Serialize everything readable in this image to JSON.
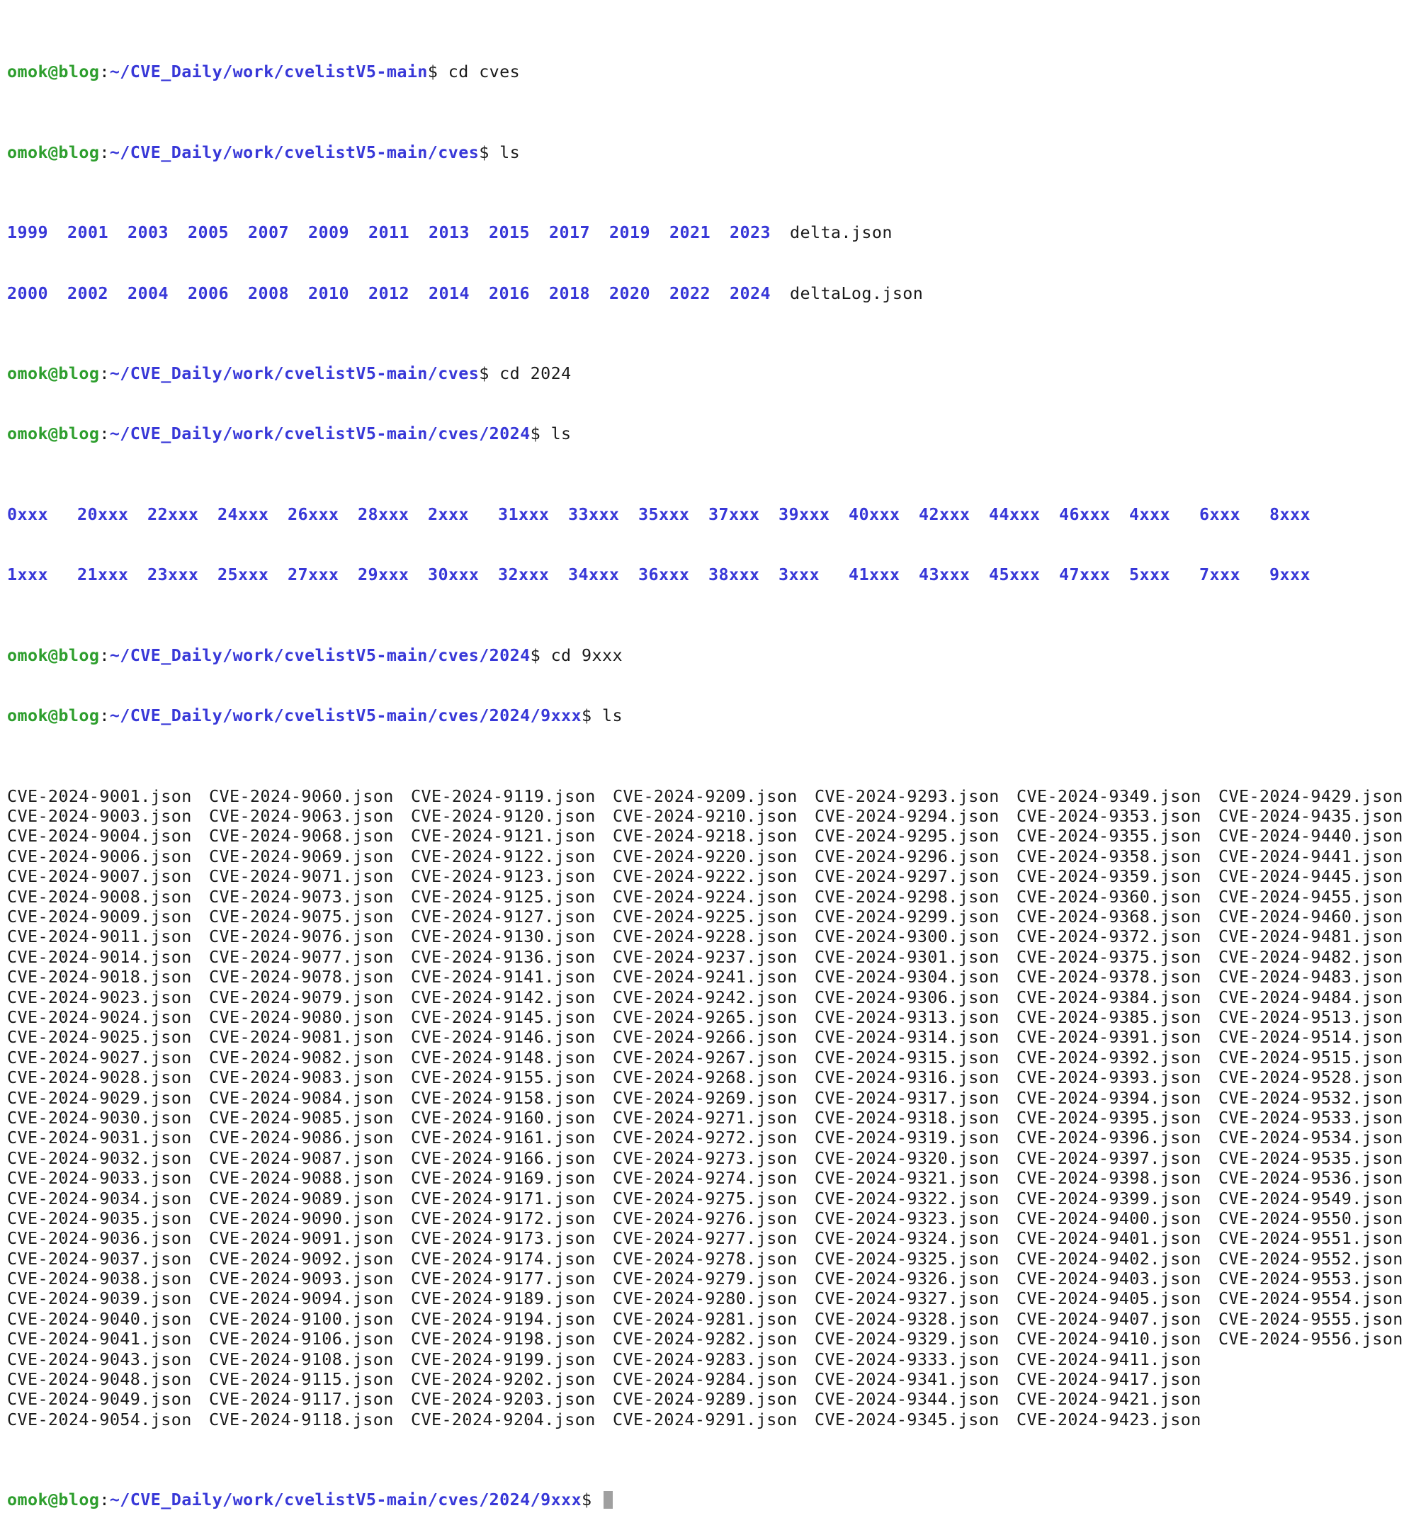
{
  "prompt": {
    "user": "omok@blog",
    "separator": ":",
    "symbol": "$"
  },
  "history": [
    {
      "path": "~/CVE_Daily/work/cvelistV5-main",
      "command": " cd cves"
    },
    {
      "path": "~/CVE_Daily/work/cvelistV5-main/cves",
      "command": " ls"
    }
  ],
  "ls_cves": {
    "row1_dirs": [
      "1999",
      "2001",
      "2003",
      "2005",
      "2007",
      "2009",
      "2011",
      "2013",
      "2015",
      "2017",
      "2019",
      "2021",
      "2023"
    ],
    "row1_file": "delta.json",
    "row2_dirs": [
      "2000",
      "2002",
      "2004",
      "2006",
      "2008",
      "2010",
      "2012",
      "2014",
      "2016",
      "2018",
      "2020",
      "2022",
      "2024"
    ],
    "row2_file": "deltaLog.json"
  },
  "history2": [
    {
      "path": "~/CVE_Daily/work/cvelistV5-main/cves",
      "command": " cd 2024"
    },
    {
      "path": "~/CVE_Daily/work/cvelistV5-main/cves/2024",
      "command": " ls"
    }
  ],
  "ls_2024": {
    "row1": [
      "0xxx",
      "20xxx",
      "22xxx",
      "24xxx",
      "26xxx",
      "28xxx",
      "2xxx",
      "31xxx",
      "33xxx",
      "35xxx",
      "37xxx",
      "39xxx",
      "40xxx",
      "42xxx",
      "44xxx",
      "46xxx",
      "4xxx",
      "6xxx",
      "8xxx"
    ],
    "row2": [
      "1xxx",
      "21xxx",
      "23xxx",
      "25xxx",
      "27xxx",
      "29xxx",
      "30xxx",
      "32xxx",
      "34xxx",
      "36xxx",
      "38xxx",
      "3xxx",
      "41xxx",
      "43xxx",
      "45xxx",
      "47xxx",
      "5xxx",
      "7xxx",
      "9xxx"
    ]
  },
  "history3": [
    {
      "path": "~/CVE_Daily/work/cvelistV5-main/cves/2024",
      "command": " cd 9xxx"
    },
    {
      "path": "~/CVE_Daily/work/cvelistV5-main/cves/2024/9xxx",
      "command": " ls"
    }
  ],
  "ls_9xxx_rows": [
    [
      "CVE-2024-9001.json",
      "CVE-2024-9060.json",
      "CVE-2024-9119.json",
      "CVE-2024-9209.json",
      "CVE-2024-9293.json",
      "CVE-2024-9349.json",
      "CVE-2024-9429.json"
    ],
    [
      "CVE-2024-9003.json",
      "CVE-2024-9063.json",
      "CVE-2024-9120.json",
      "CVE-2024-9210.json",
      "CVE-2024-9294.json",
      "CVE-2024-9353.json",
      "CVE-2024-9435.json"
    ],
    [
      "CVE-2024-9004.json",
      "CVE-2024-9068.json",
      "CVE-2024-9121.json",
      "CVE-2024-9218.json",
      "CVE-2024-9295.json",
      "CVE-2024-9355.json",
      "CVE-2024-9440.json"
    ],
    [
      "CVE-2024-9006.json",
      "CVE-2024-9069.json",
      "CVE-2024-9122.json",
      "CVE-2024-9220.json",
      "CVE-2024-9296.json",
      "CVE-2024-9358.json",
      "CVE-2024-9441.json"
    ],
    [
      "CVE-2024-9007.json",
      "CVE-2024-9071.json",
      "CVE-2024-9123.json",
      "CVE-2024-9222.json",
      "CVE-2024-9297.json",
      "CVE-2024-9359.json",
      "CVE-2024-9445.json"
    ],
    [
      "CVE-2024-9008.json",
      "CVE-2024-9073.json",
      "CVE-2024-9125.json",
      "CVE-2024-9224.json",
      "CVE-2024-9298.json",
      "CVE-2024-9360.json",
      "CVE-2024-9455.json"
    ],
    [
      "CVE-2024-9009.json",
      "CVE-2024-9075.json",
      "CVE-2024-9127.json",
      "CVE-2024-9225.json",
      "CVE-2024-9299.json",
      "CVE-2024-9368.json",
      "CVE-2024-9460.json"
    ],
    [
      "CVE-2024-9011.json",
      "CVE-2024-9076.json",
      "CVE-2024-9130.json",
      "CVE-2024-9228.json",
      "CVE-2024-9300.json",
      "CVE-2024-9372.json",
      "CVE-2024-9481.json"
    ],
    [
      "CVE-2024-9014.json",
      "CVE-2024-9077.json",
      "CVE-2024-9136.json",
      "CVE-2024-9237.json",
      "CVE-2024-9301.json",
      "CVE-2024-9375.json",
      "CVE-2024-9482.json"
    ],
    [
      "CVE-2024-9018.json",
      "CVE-2024-9078.json",
      "CVE-2024-9141.json",
      "CVE-2024-9241.json",
      "CVE-2024-9304.json",
      "CVE-2024-9378.json",
      "CVE-2024-9483.json"
    ],
    [
      "CVE-2024-9023.json",
      "CVE-2024-9079.json",
      "CVE-2024-9142.json",
      "CVE-2024-9242.json",
      "CVE-2024-9306.json",
      "CVE-2024-9384.json",
      "CVE-2024-9484.json"
    ],
    [
      "CVE-2024-9024.json",
      "CVE-2024-9080.json",
      "CVE-2024-9145.json",
      "CVE-2024-9265.json",
      "CVE-2024-9313.json",
      "CVE-2024-9385.json",
      "CVE-2024-9513.json"
    ],
    [
      "CVE-2024-9025.json",
      "CVE-2024-9081.json",
      "CVE-2024-9146.json",
      "CVE-2024-9266.json",
      "CVE-2024-9314.json",
      "CVE-2024-9391.json",
      "CVE-2024-9514.json"
    ],
    [
      "CVE-2024-9027.json",
      "CVE-2024-9082.json",
      "CVE-2024-9148.json",
      "CVE-2024-9267.json",
      "CVE-2024-9315.json",
      "CVE-2024-9392.json",
      "CVE-2024-9515.json"
    ],
    [
      "CVE-2024-9028.json",
      "CVE-2024-9083.json",
      "CVE-2024-9155.json",
      "CVE-2024-9268.json",
      "CVE-2024-9316.json",
      "CVE-2024-9393.json",
      "CVE-2024-9528.json"
    ],
    [
      "CVE-2024-9029.json",
      "CVE-2024-9084.json",
      "CVE-2024-9158.json",
      "CVE-2024-9269.json",
      "CVE-2024-9317.json",
      "CVE-2024-9394.json",
      "CVE-2024-9532.json"
    ],
    [
      "CVE-2024-9030.json",
      "CVE-2024-9085.json",
      "CVE-2024-9160.json",
      "CVE-2024-9271.json",
      "CVE-2024-9318.json",
      "CVE-2024-9395.json",
      "CVE-2024-9533.json"
    ],
    [
      "CVE-2024-9031.json",
      "CVE-2024-9086.json",
      "CVE-2024-9161.json",
      "CVE-2024-9272.json",
      "CVE-2024-9319.json",
      "CVE-2024-9396.json",
      "CVE-2024-9534.json"
    ],
    [
      "CVE-2024-9032.json",
      "CVE-2024-9087.json",
      "CVE-2024-9166.json",
      "CVE-2024-9273.json",
      "CVE-2024-9320.json",
      "CVE-2024-9397.json",
      "CVE-2024-9535.json"
    ],
    [
      "CVE-2024-9033.json",
      "CVE-2024-9088.json",
      "CVE-2024-9169.json",
      "CVE-2024-9274.json",
      "CVE-2024-9321.json",
      "CVE-2024-9398.json",
      "CVE-2024-9536.json"
    ],
    [
      "CVE-2024-9034.json",
      "CVE-2024-9089.json",
      "CVE-2024-9171.json",
      "CVE-2024-9275.json",
      "CVE-2024-9322.json",
      "CVE-2024-9399.json",
      "CVE-2024-9549.json"
    ],
    [
      "CVE-2024-9035.json",
      "CVE-2024-9090.json",
      "CVE-2024-9172.json",
      "CVE-2024-9276.json",
      "CVE-2024-9323.json",
      "CVE-2024-9400.json",
      "CVE-2024-9550.json"
    ],
    [
      "CVE-2024-9036.json",
      "CVE-2024-9091.json",
      "CVE-2024-9173.json",
      "CVE-2024-9277.json",
      "CVE-2024-9324.json",
      "CVE-2024-9401.json",
      "CVE-2024-9551.json"
    ],
    [
      "CVE-2024-9037.json",
      "CVE-2024-9092.json",
      "CVE-2024-9174.json",
      "CVE-2024-9278.json",
      "CVE-2024-9325.json",
      "CVE-2024-9402.json",
      "CVE-2024-9552.json"
    ],
    [
      "CVE-2024-9038.json",
      "CVE-2024-9093.json",
      "CVE-2024-9177.json",
      "CVE-2024-9279.json",
      "CVE-2024-9326.json",
      "CVE-2024-9403.json",
      "CVE-2024-9553.json"
    ],
    [
      "CVE-2024-9039.json",
      "CVE-2024-9094.json",
      "CVE-2024-9189.json",
      "CVE-2024-9280.json",
      "CVE-2024-9327.json",
      "CVE-2024-9405.json",
      "CVE-2024-9554.json"
    ],
    [
      "CVE-2024-9040.json",
      "CVE-2024-9100.json",
      "CVE-2024-9194.json",
      "CVE-2024-9281.json",
      "CVE-2024-9328.json",
      "CVE-2024-9407.json",
      "CVE-2024-9555.json"
    ],
    [
      "CVE-2024-9041.json",
      "CVE-2024-9106.json",
      "CVE-2024-9198.json",
      "CVE-2024-9282.json",
      "CVE-2024-9329.json",
      "CVE-2024-9410.json",
      "CVE-2024-9556.json"
    ],
    [
      "CVE-2024-9043.json",
      "CVE-2024-9108.json",
      "CVE-2024-9199.json",
      "CVE-2024-9283.json",
      "CVE-2024-9333.json",
      "CVE-2024-9411.json"
    ],
    [
      "CVE-2024-9048.json",
      "CVE-2024-9115.json",
      "CVE-2024-9202.json",
      "CVE-2024-9284.json",
      "CVE-2024-9341.json",
      "CVE-2024-9417.json"
    ],
    [
      "CVE-2024-9049.json",
      "CVE-2024-9117.json",
      "CVE-2024-9203.json",
      "CVE-2024-9289.json",
      "CVE-2024-9344.json",
      "CVE-2024-9421.json"
    ],
    [
      "CVE-2024-9054.json",
      "CVE-2024-9118.json",
      "CVE-2024-9204.json",
      "CVE-2024-9291.json",
      "CVE-2024-9345.json",
      "CVE-2024-9423.json"
    ]
  ],
  "final_prompt": {
    "path": "~/CVE_Daily/work/cvelistV5-main/cves/2024/9xxx",
    "command": " "
  },
  "colors": {
    "background": "#ffffff",
    "text": "#1a1a1a",
    "prompt_user": "#2e9e2e",
    "prompt_path": "#3838d8",
    "directory": "#3838d8",
    "cursor": "#a0a0a0"
  }
}
